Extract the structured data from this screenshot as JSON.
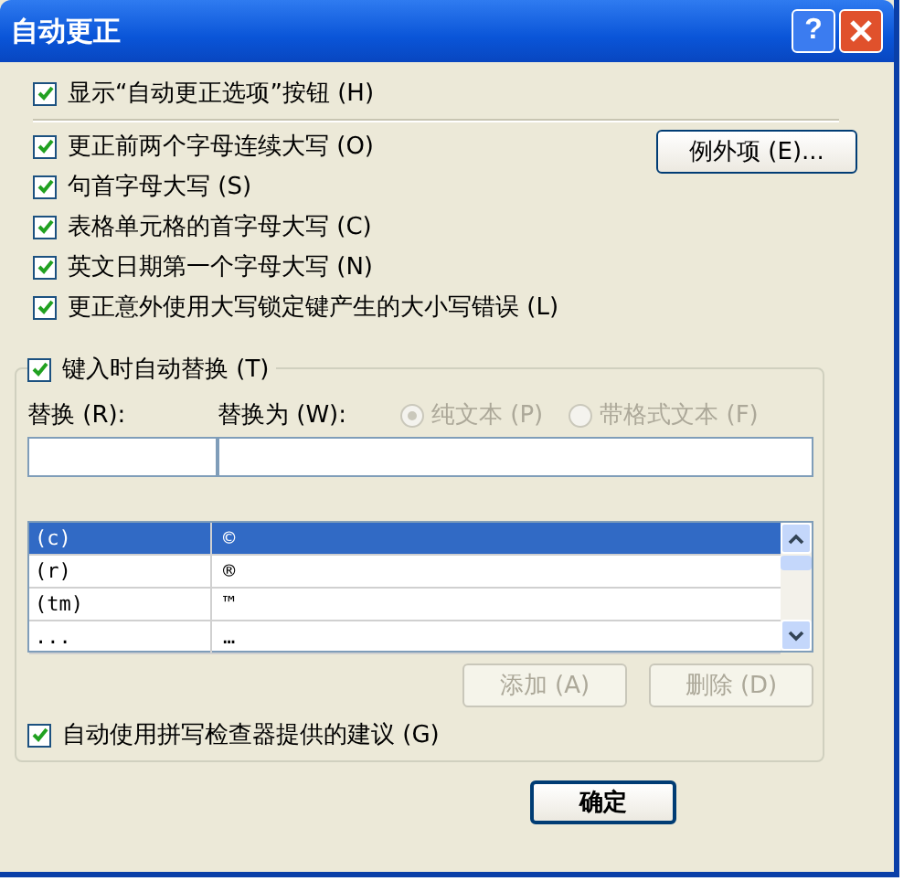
{
  "window": {
    "title": "自动更正",
    "help": "?"
  },
  "show_options_button": {
    "label": "显示“自动更正选项”按钮 (H)",
    "checked": true
  },
  "options": [
    {
      "label": "更正前两个字母连续大写 (O)",
      "checked": true
    },
    {
      "label": "句首字母大写 (S)",
      "checked": true
    },
    {
      "label": "表格单元格的首字母大写 (C)",
      "checked": true
    },
    {
      "label": "英文日期第一个字母大写 (N)",
      "checked": true
    },
    {
      "label": "更正意外使用大写锁定键产生的大小写错误 (L)",
      "checked": true
    }
  ],
  "exceptions_button": {
    "label": "例外项 (E)..."
  },
  "replace_group": {
    "label": "键入时自动替换 (T)",
    "checked": true,
    "replace_label": "替换 (R):",
    "with_label": "替换为 (W):",
    "format_options": [
      {
        "label": "纯文本 (P)",
        "selected": true,
        "disabled": true
      },
      {
        "label": "带格式文本 (F)",
        "selected": false,
        "disabled": true
      }
    ],
    "entries": [
      {
        "replace": "(c)",
        "with": "©",
        "selected": true
      },
      {
        "replace": "(r)",
        "with": "®",
        "selected": false
      },
      {
        "replace": "(tm)",
        "with": "™",
        "selected": false
      },
      {
        "replace": "...",
        "with": "…",
        "selected": false
      }
    ],
    "buttons": [
      {
        "label": "添加 (A)",
        "disabled": true
      },
      {
        "label": "删除 (D)",
        "disabled": true
      }
    ],
    "spelling": {
      "label": "自动使用拼写检查器提供的建议 (G)",
      "checked": true
    }
  },
  "ok_button": {
    "label": "确定"
  }
}
